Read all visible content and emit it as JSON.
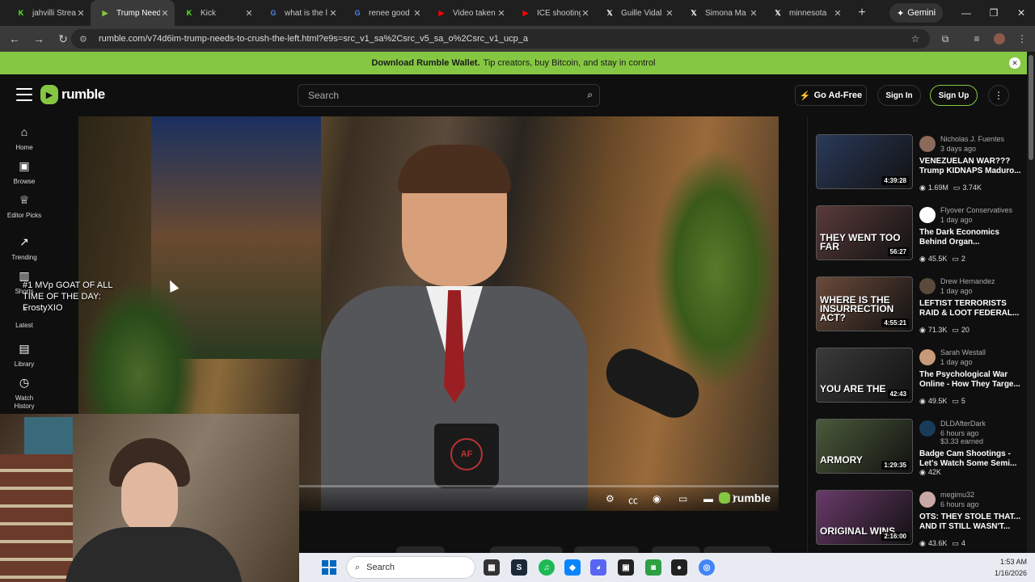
{
  "browser": {
    "tabs": [
      {
        "label": "jahvilli Stream",
        "favicon": "kick-icon",
        "color": "#53fc18",
        "glyph": "K"
      },
      {
        "label": "Trump Needs",
        "favicon": "rumble-icon",
        "color": "#85c742",
        "glyph": "▶",
        "active": true
      },
      {
        "label": "Kick",
        "favicon": "kick-icon",
        "color": "#53fc18",
        "glyph": "K"
      },
      {
        "label": "what is the l",
        "favicon": "google-icon",
        "color": "#4285f4",
        "glyph": "G"
      },
      {
        "label": "renee good",
        "favicon": "google-icon",
        "color": "#4285f4",
        "glyph": "G"
      },
      {
        "label": "Video taken",
        "favicon": "youtube-icon",
        "color": "#ff0000",
        "glyph": "▶"
      },
      {
        "label": "ICE shooting",
        "favicon": "youtube-icon",
        "color": "#ff0000",
        "glyph": "▶"
      },
      {
        "label": "Guille Vidal",
        "favicon": "x-icon",
        "color": "#ffffff",
        "glyph": "𝕏"
      },
      {
        "label": "Simona Ma",
        "favicon": "x-icon",
        "color": "#ffffff",
        "glyph": "𝕏"
      },
      {
        "label": "minnesota",
        "favicon": "x-icon",
        "color": "#ffffff",
        "glyph": "𝕏"
      }
    ],
    "gemini_label": "Gemini",
    "url": "rumble.com/v74d6im-trump-needs-to-crush-the-left.html?e9s=src_v1_sa%2Csrc_v5_sa_o%2Csrc_v1_ucp_a"
  },
  "banner": {
    "bold": "Download Rumble Wallet.",
    "text": "Tip creators, buy Bitcoin, and stay in control"
  },
  "header": {
    "logo_text": "rumble",
    "search_placeholder": "Search",
    "go_ad_free": "Go Ad-Free",
    "sign_in": "Sign In",
    "sign_up": "Sign Up"
  },
  "nav": {
    "items": [
      {
        "label": "Home",
        "icon": "home-icon",
        "glyph": "⌂"
      },
      {
        "label": "Browse",
        "icon": "browse-icon",
        "glyph": "▣"
      },
      {
        "label": "Editor Picks",
        "icon": "award-icon",
        "glyph": "♕"
      },
      {
        "label": "Trending",
        "icon": "trending-icon",
        "glyph": "↗"
      },
      {
        "label": "Shorts",
        "icon": "shorts-icon",
        "glyph": "▥"
      },
      {
        "label": "Latest",
        "icon": "latest-icon",
        "glyph": "◔"
      },
      {
        "label": "Library",
        "icon": "library-icon",
        "glyph": "▤"
      },
      {
        "label": "Watch History",
        "icon": "history-icon",
        "glyph": "◷"
      }
    ]
  },
  "overlay": {
    "line1": "#1 MVp GOAT OF ALL",
    "line2": "TIME OF THE DAY:",
    "line3": "FrostyXIO"
  },
  "video": {
    "mug_text": "AF",
    "logo_text": "rumble"
  },
  "recommendations": [
    {
      "channel": "Nicholas J. Fuentes",
      "time": "3 days ago",
      "title": "VENEZUELAN WAR??? Trump KIDNAPS Maduro...",
      "duration": "4:39:28",
      "views": "1.69M",
      "comments": "3.74K",
      "thumb_text": "",
      "thumb_color": "#2a3a5a",
      "avatar_color": "#8a6a5a"
    },
    {
      "channel": "Flyover Conservatives",
      "time": "1 day ago",
      "title": "The Dark Economics Behind Organ...",
      "duration": "56:27",
      "views": "45.5K",
      "comments": "2",
      "thumb_text": "THEY WENT TOO FAR",
      "thumb_color": "#5a3a3a",
      "avatar_color": "#ffffff"
    },
    {
      "channel": "Drew Hernandez",
      "time": "1 day ago",
      "title": "LEFTIST TERRORISTS RAID & LOOT FEDERAL...",
      "duration": "4:55:21",
      "views": "71.3K",
      "comments": "20",
      "thumb_text": "WHERE IS THE INSURRECTION ACT?",
      "thumb_color": "#6a4a3a",
      "avatar_color": "#5a4a3a"
    },
    {
      "channel": "Sarah Westall",
      "time": "1 day ago",
      "title": "The Psychological War Online - How They Targe...",
      "duration": "42:43",
      "views": "49.5K",
      "comments": "5",
      "thumb_text": "YOU ARE THE",
      "thumb_color": "#3a3a3a",
      "avatar_color": "#c89a7a"
    },
    {
      "channel": "DLDAfterDark",
      "time": "6 hours ago",
      "earned": "$3.33 earned",
      "title": "Badge Cam Shootings - Let's Watch Some Semi...",
      "duration": "1:29:35",
      "views": "42K",
      "comments": "",
      "thumb_text": "ARMORY",
      "thumb_color": "#4a5a3a",
      "avatar_color": "#1a3a5a"
    },
    {
      "channel": "megimu32",
      "time": "6 hours ago",
      "title": "OTS: THEY STOLE THAT... AND IT STILL WASN'T...",
      "duration": "2:16:00",
      "views": "43.6K",
      "comments": "4",
      "thumb_text": "ORIGINAL WINS",
      "thumb_color": "#6a3a6a",
      "avatar_color": "#c8a8a8"
    }
  ],
  "taskbar": {
    "search_label": "Search",
    "time": "1:53 AM",
    "date": "1/16/2026"
  }
}
